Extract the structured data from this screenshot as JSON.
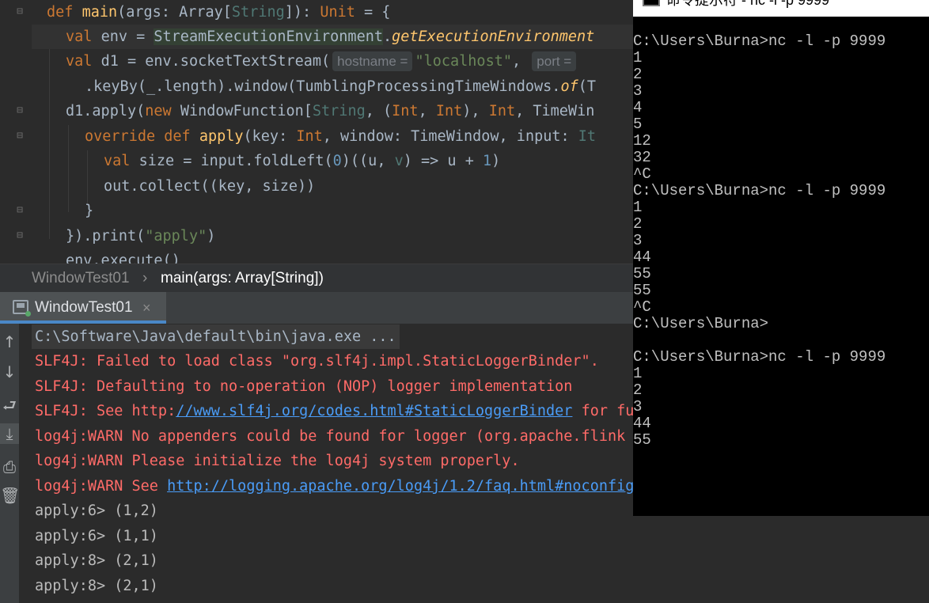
{
  "editor": {
    "line1": {
      "kw": "def ",
      "fn": "main",
      "p1": "(args: Array[",
      "gen": "String",
      "p2": "]): ",
      "ty": "Unit",
      "p3": " = {"
    },
    "line2": {
      "kw": "val ",
      "p1": "env = ",
      "hl": "StreamExecutionEnvironment",
      "p2": ".",
      "it": "getExecutionEnvironment"
    },
    "line3": {
      "kw": "val ",
      "p1": "d1 = env.socketTextStream(",
      "hint1": "hostname =",
      "str": "\"localhost\"",
      "p2": ", ",
      "hint2": "port ="
    },
    "line4": {
      "p1": ".keyBy(_.length).window(TumblingProcessingTimeWindows.",
      "it": "of",
      "p2": "(T"
    },
    "line5": {
      "p1": "d1.apply(",
      "kw": "new ",
      "p2": "WindowFunction[",
      "gen": "String",
      "p3": ", (",
      "ty1": "Int",
      "p4": ", ",
      "ty2": "Int",
      "p5": "), ",
      "ty3": "Int",
      "p6": ", TimeWin"
    },
    "line6": {
      "kw1": "override ",
      "kw2": "def ",
      "fn": "apply",
      "p1": "(key: ",
      "ty": "Int",
      "p2": ", window: TimeWindow, input: ",
      "gen": "It"
    },
    "line7": {
      "kw": "val ",
      "p1": "size = input.foldLeft(",
      "n0": "0",
      "p2": ")((",
      "u": "u",
      "p3": ", ",
      "v": "v",
      "p4": ") => u + ",
      "n1": "1",
      "p5": ")"
    },
    "line8": {
      "p1": "out.collect((key, size))"
    },
    "line9": {
      "p1": "}"
    },
    "line10": {
      "p1": "}).print(",
      "str": "\"apply\"",
      "p2": ")"
    },
    "line11": {
      "p1": "env.execute()"
    }
  },
  "breadcrumb": {
    "item1": "WindowTest01",
    "separator": "›",
    "item2": "main(args: Array[String])"
  },
  "run_tab": {
    "label": "WindowTest01",
    "close": "×"
  },
  "console": {
    "cmd": "C:\\Software\\Java\\default\\bin\\java.exe ...",
    "err1": "SLF4J: Failed to load class \"org.slf4j.impl.StaticLoggerBinder\".",
    "err2": "SLF4J: Defaulting to no-operation (NOP) logger implementation",
    "err3_pre": "SLF4J: See http:",
    "err3_link": "//www.slf4j.org/codes.html#StaticLoggerBinder",
    "err3_post": " for further details.",
    "err4": "log4j:WARN No appenders could be found for logger (org.apache.flink",
    "err5": "log4j:WARN Please initialize the log4j system properly.",
    "err6_pre": "log4j:WARN See ",
    "err6_link": "http://logging.apache.org/log4j/1.2/faq.html#noconfig",
    "out1": "apply:6> (1,2)",
    "out2": "apply:6> (1,1)",
    "out3": "apply:8> (2,1)",
    "out4": "apply:8> (2,1)"
  },
  "sidebar_icons": [
    "arrow-up-icon",
    "arrow-down-icon",
    "soft-wrap-icon",
    "scroll-to-end-icon",
    "print-icon",
    "trash-icon"
  ],
  "terminal": {
    "title": "命令提示符 - nc -l -p 9999",
    "lines": [
      "",
      "",
      "C:\\Users\\Burna>nc -l -p 9999",
      "1",
      "2",
      "3",
      "4",
      "5",
      "12",
      "32",
      "^C",
      "C:\\Users\\Burna>nc -l -p 9999",
      "1",
      "2",
      "3",
      "44",
      "55",
      "55",
      "^C",
      "C:\\Users\\Burna>",
      "",
      "C:\\Users\\Burna>nc -l -p 9999",
      "1",
      "2",
      "3",
      "44",
      "55"
    ]
  }
}
